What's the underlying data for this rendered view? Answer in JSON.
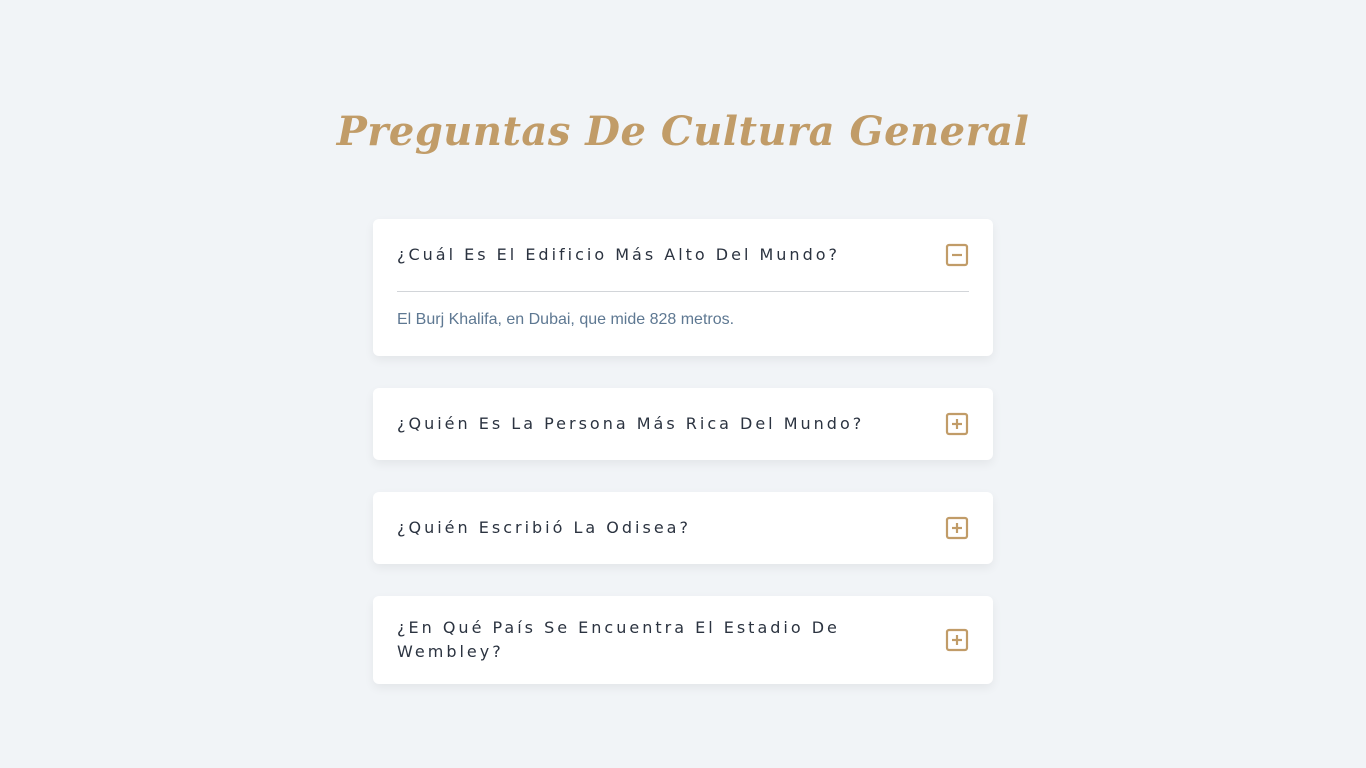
{
  "page": {
    "title": "Preguntas De Cultura General"
  },
  "faq": {
    "items": [
      {
        "question": "¿Cuál Es El Edificio Más Alto Del Mundo?",
        "answer": "El Burj Khalifa, en Dubai, que mide 828 metros.",
        "expanded": true,
        "icon": "minus-square-icon"
      },
      {
        "question": "¿Quién Es La Persona Más Rica Del Mundo?",
        "expanded": false,
        "icon": "plus-square-icon"
      },
      {
        "question": "¿Quién Escribió La Odisea?",
        "expanded": false,
        "icon": "plus-square-icon"
      },
      {
        "question": "¿En Qué País Se Encuentra El Estadio De Wembley?",
        "expanded": false,
        "icon": "plus-square-icon"
      }
    ]
  },
  "colors": {
    "background": "#f1f4f7",
    "accent": "#c19c68",
    "question_text": "#2b3340",
    "answer_text": "#5e7892",
    "card": "#ffffff"
  }
}
